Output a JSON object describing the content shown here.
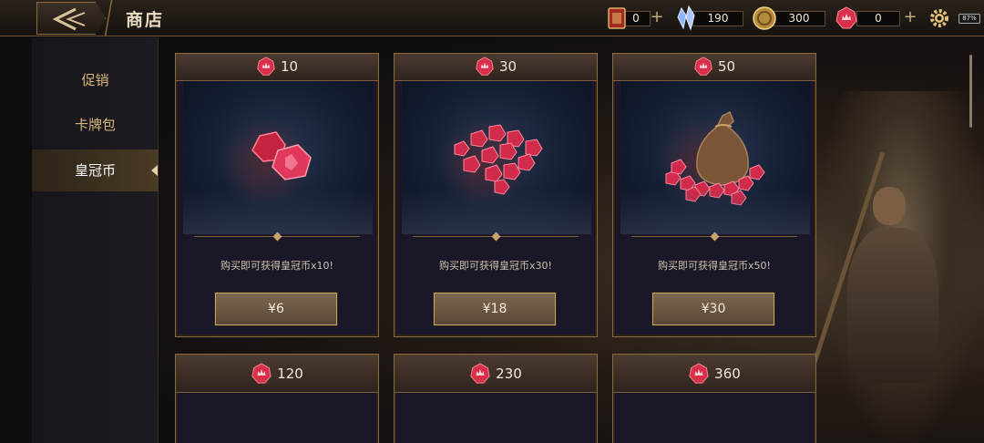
{
  "header": {
    "title": "商店",
    "resources": [
      {
        "name": "cards",
        "value": "0",
        "has_plus": true
      },
      {
        "name": "crystals",
        "value": "190",
        "has_plus": false
      },
      {
        "name": "gold",
        "value": "300",
        "has_plus": false
      },
      {
        "name": "crown-coins",
        "value": "0",
        "has_plus": true
      }
    ],
    "battery": "87%"
  },
  "sidebar": {
    "items": [
      {
        "label": "促销",
        "active": false
      },
      {
        "label": "卡牌包",
        "active": false
      },
      {
        "label": "皇冠币",
        "active": true
      }
    ]
  },
  "cards": [
    {
      "amount": "10",
      "desc": "购买即可获得皇冠币x10!",
      "price": "¥6"
    },
    {
      "amount": "30",
      "desc": "购买即可获得皇冠币x30!",
      "price": "¥18"
    },
    {
      "amount": "50",
      "desc": "购买即可获得皇冠币x50!",
      "price": "¥30"
    },
    {
      "amount": "120"
    },
    {
      "amount": "230"
    },
    {
      "amount": "360"
    }
  ],
  "colors": {
    "accent_gold": "#c9a36a",
    "gem_red": "#d8304a",
    "sidebar_text": "#d9b776"
  }
}
